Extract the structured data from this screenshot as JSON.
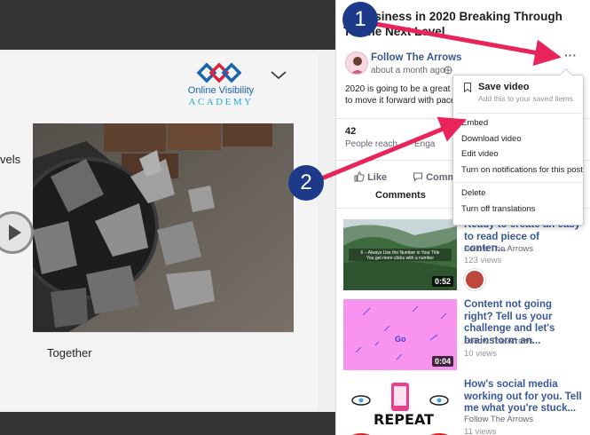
{
  "slide": {
    "partial_text": "vels",
    "logo_line1": "Online Visibility",
    "logo_line2": "ACADEMY",
    "caption": "Together"
  },
  "post": {
    "title": "ur Business in 2020 Breaking Through To The Next Level",
    "author": "Follow The Arrows",
    "time": "about a month ago · ",
    "body_line1": "2020 is going to be a great year",
    "body_line2": "to move it forward with pace?",
    "reach_number": "42",
    "reach_label": "People reach",
    "engagement_label": "Enga",
    "like_label": "Like",
    "comment_label": "Comm",
    "comments_tab": "Comments"
  },
  "menu": {
    "save_label": "Save video",
    "save_sub": "Add this to your saved items",
    "items_group1": [
      "Embed",
      "Download video",
      "Edit video",
      "Turn on notifications for this post"
    ],
    "items_group2": [
      "Delete",
      "Turn off translations"
    ]
  },
  "videos": [
    {
      "title": "Ready to create an easy to read piece of conten...",
      "author": "Follow The Arrows",
      "views": "123 views",
      "duration": "0:52",
      "thumb_text": "6 – Always Use the Number in Your Title\nYou get more clicks with a number"
    },
    {
      "title": "Content not going right? Tell us your challenge and let's brainstorm an...",
      "author": "Follow The Arrows",
      "views": "10 views",
      "duration": "0:04",
      "thumb_text": "Go"
    },
    {
      "title": "How's social media working out for you. Tell me what you're stuck...",
      "author": "Follow The Arrows",
      "views": "11 views",
      "duration": "",
      "thumb_text": "REPEAT"
    }
  ],
  "annotations": [
    "1",
    "2"
  ],
  "colors": {
    "facebook_link": "#385898",
    "arrow": "#e8245a",
    "badge": "#1d3a8a",
    "dark_bar": "#353535",
    "thumb_pink": "#f993f0"
  }
}
